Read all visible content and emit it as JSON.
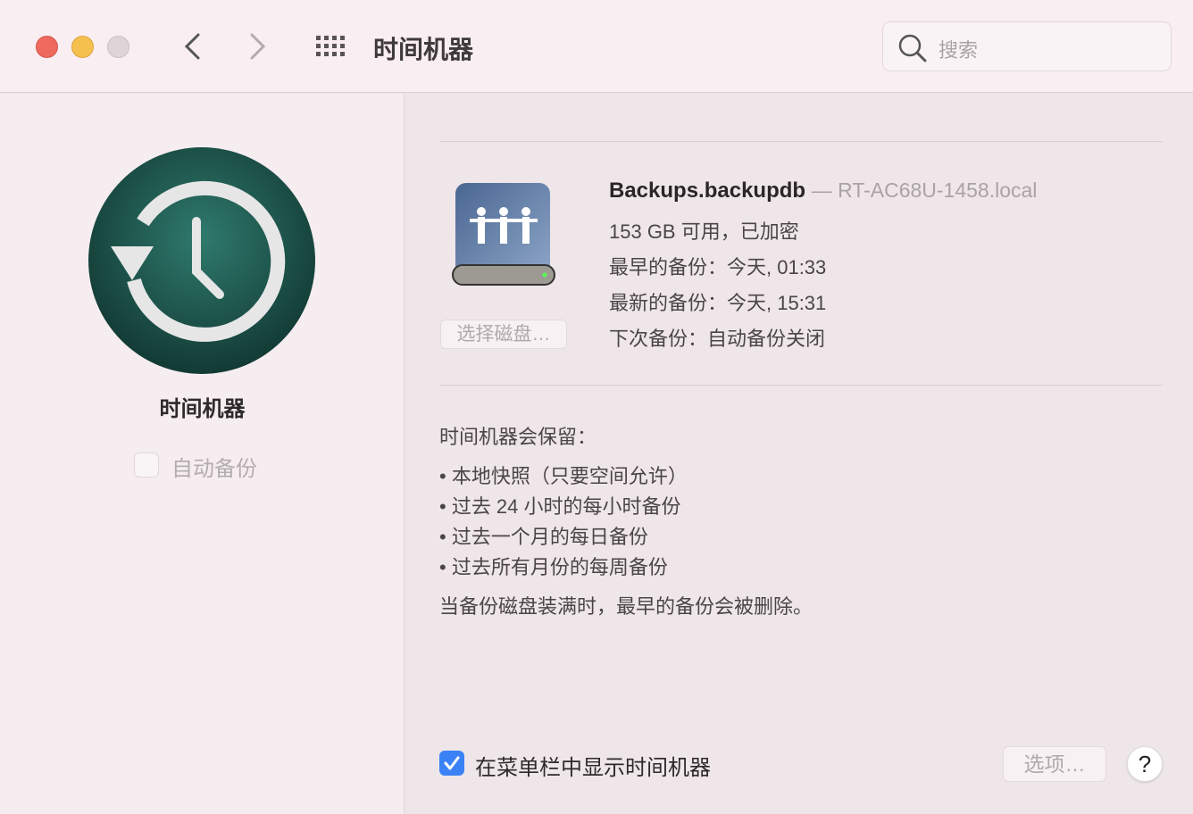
{
  "window": {
    "title": "时间机器",
    "search_placeholder": "搜索"
  },
  "sidebar": {
    "app_name": "时间机器",
    "auto_backup_label": "自动备份",
    "auto_backup_checked": false
  },
  "disk": {
    "name": "Backups.backupdb",
    "host": "— RT-AC68U-1458.local",
    "available": "153 GB 可用，已加密",
    "oldest": "最早的备份：今天, 01:33",
    "latest": "最新的备份：今天, 15:31",
    "next": "下次备份：自动备份关闭",
    "select_disk_button": "选择磁盘…"
  },
  "retention": {
    "heading": "时间机器会保留：",
    "items": [
      "• 本地快照（只要空间允许）",
      "• 过去 24 小时的每小时备份",
      "• 过去一个月的每日备份",
      "• 过去所有月份的每周备份"
    ],
    "footer": "当备份磁盘装满时，最早的备份会被删除。"
  },
  "bottom": {
    "show_in_menubar_label": "在菜单栏中显示时间机器",
    "show_in_menubar_checked": true,
    "options_button": "选项…",
    "help_button": "?"
  },
  "colors": {
    "accent": "#3b82f6",
    "close": "#ee6a5f",
    "minimize": "#f6c04f",
    "zoom_disabled": "#ddd5d8"
  }
}
